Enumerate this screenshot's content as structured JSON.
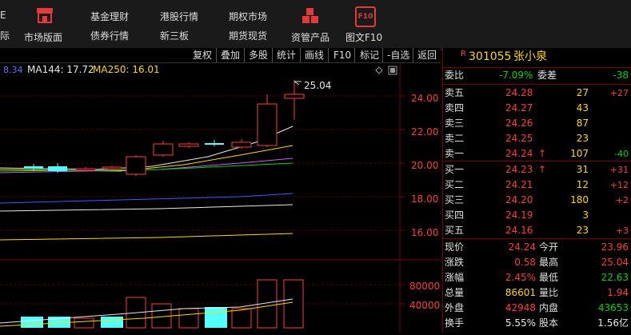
{
  "nav": {
    "left_char_top": "E",
    "left_char_bottom": "际",
    "market_label": "市场版面",
    "fund_label": "基金理财",
    "bond_label": "债券行情",
    "hk_label": "港股行情",
    "neeq_label": "新三板",
    "futures_label": "期权市场",
    "spot_label": "期货现货",
    "asset_label": "资管产品",
    "f10_label": "图文F10",
    "f10_icon_text": "F10"
  },
  "toolbar": {
    "items": [
      "复权",
      "叠加",
      "多股",
      "统计",
      "画线",
      "F10",
      "标记",
      "-自选",
      "返回"
    ]
  },
  "ma_legend": [
    {
      "text": "8.34",
      "color": "#6a6aff"
    },
    {
      "text": "MA144: 17.72",
      "color": "#e8e8e8"
    },
    {
      "text": "MA250: 16.01",
      "color": "#ffd800"
    }
  ],
  "price_axis": [
    "24.00",
    "22.00",
    "20.00",
    "18.00",
    "16.00"
  ],
  "volume_axis": [
    "80000",
    "40000"
  ],
  "high_marker": "25.04",
  "stock": {
    "code": "301055",
    "name": "张小泉",
    "r_badge": "R"
  },
  "weibi": {
    "label": "委比",
    "value": "-7.09%",
    "diff_label": "委差",
    "diff": "-38"
  },
  "asks": [
    {
      "label": "卖五",
      "price": "24.28",
      "vol": "27",
      "chg": "+27"
    },
    {
      "label": "卖四",
      "price": "24.27",
      "vol": "43",
      "chg": ""
    },
    {
      "label": "卖三",
      "price": "24.26",
      "vol": "87",
      "chg": ""
    },
    {
      "label": "卖二",
      "price": "24.25",
      "vol": "23",
      "chg": ""
    },
    {
      "label": "卖一",
      "price": "24.24",
      "vol": "107",
      "chg": "-40",
      "arrow": "↑"
    }
  ],
  "bids": [
    {
      "label": "买一",
      "price": "24.23",
      "vol": "31",
      "chg": "+31",
      "arrow": "↑"
    },
    {
      "label": "买二",
      "price": "24.21",
      "vol": "12",
      "chg": "+12"
    },
    {
      "label": "买三",
      "price": "24.20",
      "vol": "180",
      "chg": "+2"
    },
    {
      "label": "买四",
      "price": "24.19",
      "vol": "3",
      "chg": ""
    },
    {
      "label": "买五",
      "price": "24.16",
      "vol": "23",
      "chg": "+3"
    }
  ],
  "quote": [
    {
      "l1": "现价",
      "v1": "24.24",
      "c1": "red",
      "l2": "今开",
      "v2": "23.96",
      "c2": "red"
    },
    {
      "l1": "涨跌",
      "v1": "0.58",
      "c1": "red",
      "l2": "最高",
      "v2": "25.04",
      "c2": "red"
    },
    {
      "l1": "涨幅",
      "v1": "2.45%",
      "c1": "red",
      "l2": "最低",
      "v2": "22.63",
      "c2": "grn"
    },
    {
      "l1": "总量",
      "v1": "86601",
      "c1": "yel",
      "l2": "量比",
      "v2": "1.94",
      "c2": "red"
    },
    {
      "l1": "外盘",
      "v1": "42948",
      "c1": "red",
      "l2": "内盘",
      "v2": "43653",
      "c2": "grn"
    },
    {
      "l1": "换手",
      "v1": "5.55%",
      "c1": "wht",
      "l2": "股本",
      "v2": "1.56亿",
      "c2": "wht"
    }
  ],
  "colors": {
    "up": "#ff3b3b",
    "down": "#00d500",
    "ma_white": "#e8e8e8",
    "ma_yellow": "#ffd800",
    "ma_blue": "#3a5cff",
    "ma_purple": "#c060ff",
    "cyan_bar": "#54ffff"
  }
}
